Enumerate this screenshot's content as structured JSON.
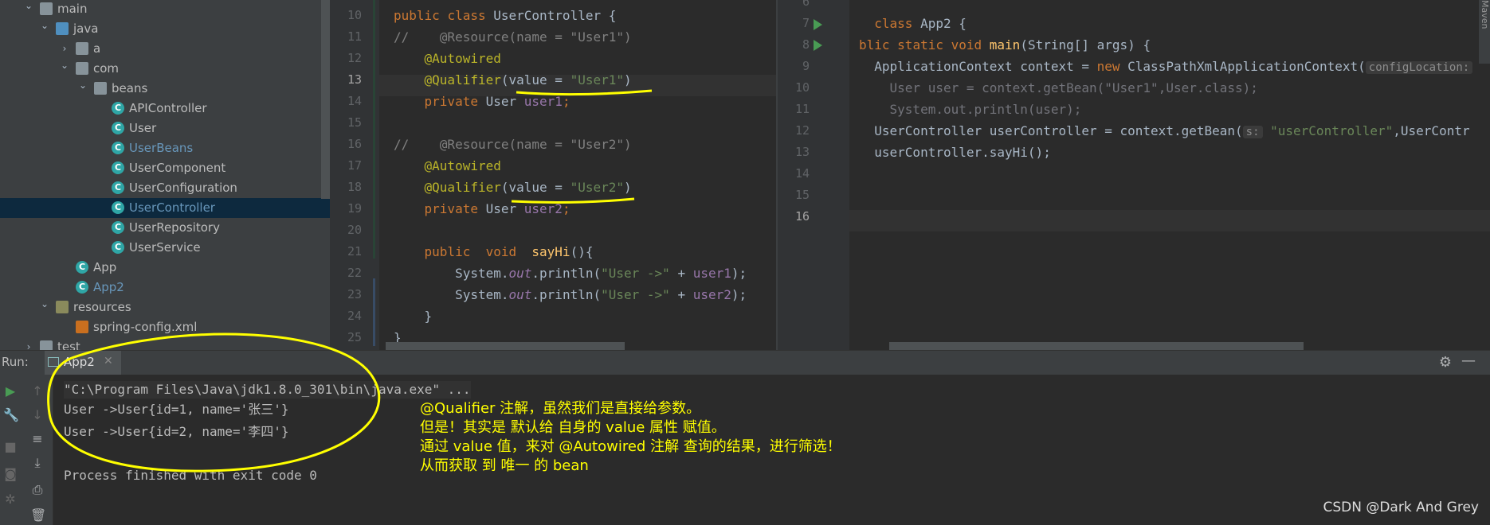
{
  "project_tree": {
    "items": [
      {
        "label": "main",
        "type": "folder",
        "expanded": true
      },
      {
        "label": "java",
        "type": "source-folder",
        "expanded": true
      },
      {
        "label": "a",
        "type": "package",
        "expanded": false
      },
      {
        "label": "com",
        "type": "package",
        "expanded": true
      },
      {
        "label": "beans",
        "type": "package",
        "expanded": true
      },
      {
        "label": "APIController",
        "type": "class"
      },
      {
        "label": "User",
        "type": "class"
      },
      {
        "label": "UserBeans",
        "type": "class",
        "color": "#6897bb"
      },
      {
        "label": "UserComponent",
        "type": "class"
      },
      {
        "label": "UserConfiguration",
        "type": "class"
      },
      {
        "label": "UserController",
        "type": "class",
        "selected": true,
        "color": "#6897bb"
      },
      {
        "label": "UserRepository",
        "type": "class"
      },
      {
        "label": "UserService",
        "type": "class"
      },
      {
        "label": "App",
        "type": "main-class"
      },
      {
        "label": "App2",
        "type": "main-class",
        "color": "#6897bb"
      },
      {
        "label": "resources",
        "type": "resource-folder",
        "expanded": true
      },
      {
        "label": "spring-config.xml",
        "type": "xml"
      },
      {
        "label": "test",
        "type": "folder",
        "expanded": false
      }
    ]
  },
  "editor_left": {
    "line_numbers": [
      "10",
      "11",
      "12",
      "13",
      "14",
      "15",
      "16",
      "17",
      "18",
      "19",
      "20",
      "21",
      "22",
      "23",
      "24",
      "25"
    ],
    "current_line": "13",
    "lines": [
      [
        {
          "t": "public ",
          "c": "kw"
        },
        {
          "t": "class ",
          "c": "kw"
        },
        {
          "t": "UserController {",
          "c": "cls"
        }
      ],
      [
        {
          "t": "//    @Resource(name = \"User1\")",
          "c": "cmt"
        }
      ],
      [
        {
          "t": "    @Autowired",
          "c": "ann"
        }
      ],
      [
        {
          "t": "    @Qualifier",
          "c": "ann"
        },
        {
          "t": "(value = ",
          "c": "cls"
        },
        {
          "t": "\"User1\"",
          "c": "str"
        },
        {
          "t": ")",
          "c": "cls"
        }
      ],
      [
        {
          "t": "    private ",
          "c": "kw"
        },
        {
          "t": "User ",
          "c": "cls"
        },
        {
          "t": "user1",
          "c": "fld"
        },
        {
          "t": ";",
          "c": "kw"
        }
      ],
      [],
      [
        {
          "t": "//    @Resource(name = \"User2\")",
          "c": "cmt"
        }
      ],
      [
        {
          "t": "    @Autowired",
          "c": "ann"
        }
      ],
      [
        {
          "t": "    @Qualifier",
          "c": "ann"
        },
        {
          "t": "(value = ",
          "c": "cls"
        },
        {
          "t": "\"User2\"",
          "c": "str"
        },
        {
          "t": ")",
          "c": "cls"
        }
      ],
      [
        {
          "t": "    private ",
          "c": "kw"
        },
        {
          "t": "User ",
          "c": "cls"
        },
        {
          "t": "user2",
          "c": "fld"
        },
        {
          "t": ";",
          "c": "kw"
        }
      ],
      [],
      [
        {
          "t": "    public  ",
          "c": "kw"
        },
        {
          "t": "void  ",
          "c": "kw"
        },
        {
          "t": "sayHi",
          "c": "mth"
        },
        {
          "t": "(){",
          "c": "cls"
        }
      ],
      [
        {
          "t": "        System.",
          "c": "cls"
        },
        {
          "t": "out",
          "c": "fldi"
        },
        {
          "t": ".println(",
          "c": "cls"
        },
        {
          "t": "\"User ->\"",
          "c": "str"
        },
        {
          "t": " + ",
          "c": "cls"
        },
        {
          "t": "user1",
          "c": "fld"
        },
        {
          "t": ");",
          "c": "cls"
        }
      ],
      [
        {
          "t": "        System.",
          "c": "cls"
        },
        {
          "t": "out",
          "c": "fldi"
        },
        {
          "t": ".println(",
          "c": "cls"
        },
        {
          "t": "\"User ->\"",
          "c": "str"
        },
        {
          "t": " + ",
          "c": "cls"
        },
        {
          "t": "user2",
          "c": "fld"
        },
        {
          "t": ");",
          "c": "cls"
        }
      ],
      [
        {
          "t": "    }",
          "c": "cls"
        }
      ],
      [
        {
          "t": "}",
          "c": "cls"
        }
      ]
    ]
  },
  "editor_right": {
    "line_numbers": [
      "6",
      "7",
      "8",
      "9",
      "10",
      "11",
      "12",
      "13",
      "14",
      "15",
      "16"
    ],
    "current_line": "16",
    "lines": [
      [],
      [
        {
          "t": "  class ",
          "c": "kw"
        },
        {
          "t": "App2 {",
          "c": "cls"
        }
      ],
      [
        {
          "t": "blic ",
          "c": "kw"
        },
        {
          "t": "static ",
          "c": "kw"
        },
        {
          "t": "void ",
          "c": "kw"
        },
        {
          "t": "main",
          "c": "mth"
        },
        {
          "t": "(String[] args) {",
          "c": "cls"
        }
      ],
      [
        {
          "t": "  ApplicationContext context = ",
          "c": "cls"
        },
        {
          "t": "new ",
          "c": "kw"
        },
        {
          "t": "ClassPathXmlApplicationContext(",
          "c": "cls"
        },
        {
          "t": "configLocation:",
          "c": "hint"
        }
      ],
      [
        {
          "t": "    ",
          "c": "cls"
        },
        {
          "t": "User user",
          "c": "unused"
        },
        {
          "t": " = context.getBean(\"User1\",User.class);",
          "c": "unused"
        }
      ],
      [
        {
          "t": "    System.out.println(user);",
          "c": "unused"
        }
      ],
      [
        {
          "t": "  UserController userController = context.getBean(",
          "c": "cls"
        },
        {
          "t": "s:",
          "c": "hint"
        },
        {
          "t": " \"userController\"",
          "c": "str"
        },
        {
          "t": ",UserContr",
          "c": "cls"
        }
      ],
      [
        {
          "t": "  userController.sayHi();",
          "c": "cls"
        }
      ],
      [],
      [],
      []
    ],
    "maven_label": "Maven"
  },
  "run_window": {
    "label": "Run:",
    "tab": "App2",
    "console": [
      "\"C:\\Program Files\\Java\\jdk1.8.0_301\\bin\\java.exe\" ...",
      "User ->User{id=1, name='张三'}",
      "User ->User{id=2, name='李四'}",
      "",
      "Process finished with exit code 0"
    ]
  },
  "annotation": {
    "lines": [
      "@Qualifier 注解，虽然我们是直接给参数。",
      "但是！其实是   默认给 自身的 value 属性 赋值。",
      "通过 value 值，来对 @Autowired 注解 查询的结果，进行筛选！",
      "从而获取 到   唯一 的 bean"
    ],
    "color": "#ffff00"
  },
  "watermark": "CSDN @Dark And Grey"
}
